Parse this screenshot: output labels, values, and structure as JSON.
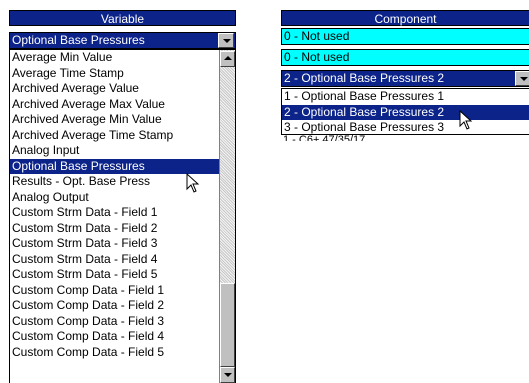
{
  "variable": {
    "header": "Variable",
    "selected_value": "Optional Base Pressures",
    "items": [
      "Average Min Value",
      "Average Time Stamp",
      "Archived Average Value",
      "Archived Average Max Value",
      "Archived Average Min Value",
      "Archived Average Time Stamp",
      "Analog Input",
      "Optional Base Pressures",
      "Results - Opt. Base Press",
      "Analog Output",
      "Custom Strm Data - Field 1",
      "Custom Strm Data - Field 2",
      "Custom Strm Data - Field 3",
      "Custom Strm Data - Field 4",
      "Custom Strm Data - Field 5",
      "Custom Comp Data - Field 1",
      "Custom Comp Data - Field 2",
      "Custom Comp Data - Field 3",
      "Custom Comp Data - Field 4",
      "Custom Comp Data - Field 5"
    ],
    "highlighted_index": 7
  },
  "component": {
    "header": "Component",
    "row1": "0 - Not used",
    "row2": "0 - Not used",
    "selected_value": "2 - Optional Base Pressures 2",
    "items": [
      "1 - Optional Base Pressures 1",
      "2 - Optional Base Pressures 2",
      "3 - Optional Base Pressures 3"
    ],
    "highlighted_index": 1,
    "partial_row": "1 - C6+ 47/35/17"
  },
  "icons": {
    "scroll_up": "triangle-up-icon",
    "scroll_down": "triangle-down-icon",
    "dropdown": "triangle-down-icon",
    "pointer": "arrow-pointer-icon"
  },
  "colors": {
    "selection": "#0c2389",
    "cyan_row": "#00ffff"
  }
}
